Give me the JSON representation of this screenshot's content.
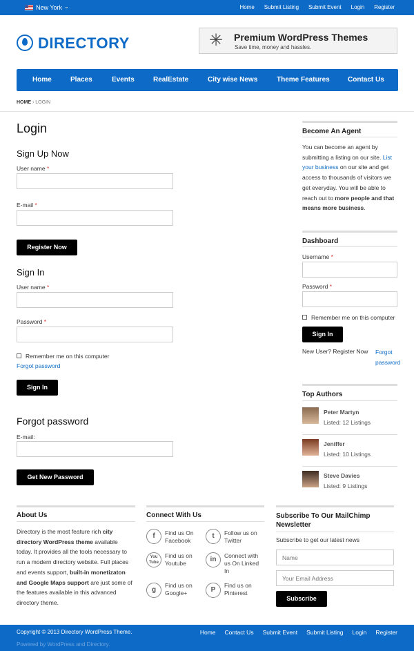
{
  "topbar": {
    "city": "New York",
    "links": [
      "Home",
      "Submit Listing",
      "Submit Event",
      "Login",
      "Register"
    ]
  },
  "logo": {
    "text": "DIRECTORY"
  },
  "banner": {
    "title": "Premium WordPress Themes",
    "subtitle": "Save time, money and hassles."
  },
  "nav": {
    "items": [
      "Home",
      "Places",
      "Events",
      "RealEstate",
      "City wise News",
      "Theme Features",
      "Contact Us"
    ]
  },
  "breadcrumb": {
    "home": "HOME",
    "current": "LOGIN"
  },
  "main": {
    "title": "Login",
    "signup": {
      "heading": "Sign Up Now",
      "username_label": "User name",
      "email_label": "E-mail",
      "button": "Register Now"
    },
    "signin": {
      "heading": "Sign In",
      "username_label": "User name",
      "password_label": "Password",
      "remember": "Remember me on this computer",
      "forgot_link": "Forgot password",
      "button": "Sign In"
    },
    "forgot": {
      "heading": "Forgot password",
      "email_label": "E-mail:",
      "button": "Get New Password"
    }
  },
  "sidebar": {
    "agent": {
      "heading": "Become An Agent",
      "t1": "You can become an agent by submitting a listing on our site.",
      "link": "List your business",
      "t2": "on our site and get access to thousands of visitors we get everyday. You will be able to reach out to",
      "bold": "more people and that means more business",
      "t3": "."
    },
    "dashboard": {
      "heading": "Dashboard",
      "username_label": "Username",
      "password_label": "Password",
      "remember": "Remember me on this computer",
      "button": "Sign In",
      "new_user": "New User? Register Now",
      "forgot": "Forgot password"
    },
    "authors": {
      "heading": "Top Authors",
      "list": [
        {
          "name": "Peter Martyn",
          "listed": "Listed: 12 Listings"
        },
        {
          "name": "Jeniffer",
          "listed": "Listed: 10 Listings"
        },
        {
          "name": "Steve Davies",
          "listed": "Listed: 9 Listings"
        }
      ]
    }
  },
  "footer": {
    "about": {
      "heading": "About Us",
      "t1": "Directory is the most feature rich",
      "b1": "city directory WordPress theme",
      "t2": "available today. It provides all the tools necessary to run a modern directory website. Full places and events support,",
      "b2": "built-in monetizaton and Google Maps support",
      "t3": "are just some of the features available in this advanced directory theme."
    },
    "connect": {
      "heading": "Connect With Us",
      "items": [
        {
          "icon": "f",
          "text": "Find us On Facebook"
        },
        {
          "icon": "t",
          "text": "Follow us on Twitter"
        },
        {
          "icon": "You Tube",
          "text": "Find us on Youtube"
        },
        {
          "icon": "in",
          "text": "Connect with us On Linked In"
        },
        {
          "icon": "g",
          "text": "Find us on Google+"
        },
        {
          "icon": "P",
          "text": "Find us on Pinterest"
        }
      ]
    },
    "subscribe": {
      "heading": "Subscribe To Our MailChimp Newsletter",
      "desc": "Subscribe to get our latest news",
      "name_ph": "Name",
      "email_ph": "Your Email Address",
      "button": "Subscribe"
    }
  },
  "bottombar": {
    "copyright": "Copyright © 2013 Directory WordPress Theme.",
    "powered": "Powered by WordPress and Directory.",
    "links": [
      "Home",
      "Contact Us",
      "Submit Event",
      "Submit Listing",
      "Login",
      "Register"
    ]
  },
  "colors": {
    "brand": "#0d6bc7",
    "button": "#000000"
  }
}
